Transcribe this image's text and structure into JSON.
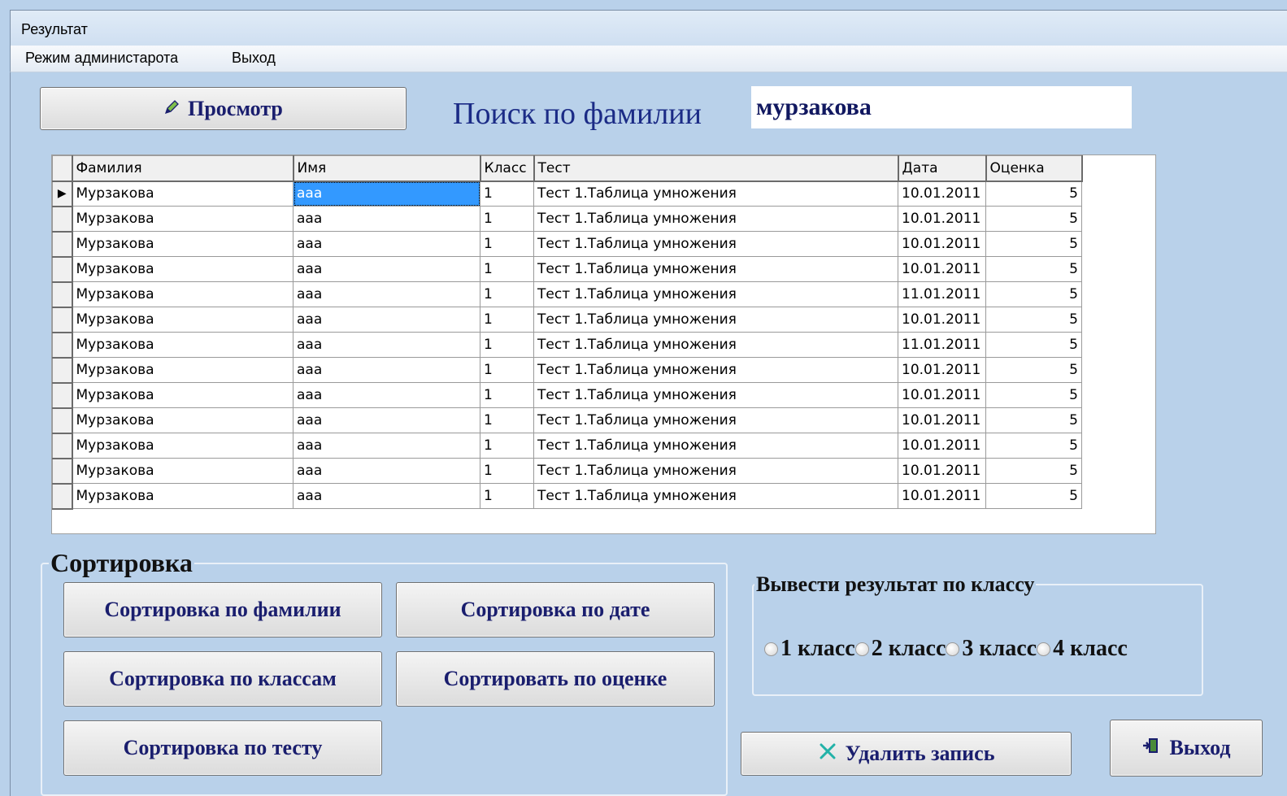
{
  "window": {
    "title": "Результат"
  },
  "menu": {
    "items": [
      "Режим администарота",
      "Выход"
    ]
  },
  "toolbar": {
    "view_label": "Просмотр"
  },
  "search": {
    "label": "Поиск по фамилии",
    "value": "мурзакова"
  },
  "grid": {
    "columns": [
      "Фамилия",
      "Имя",
      "Класс",
      "Тест",
      "Дата",
      "Оценка"
    ],
    "rows": [
      [
        "Мурзакова",
        "ааа",
        "1",
        "Тест 1.Таблица умножения",
        "10.01.2011",
        "5"
      ],
      [
        "Мурзакова",
        "ааа",
        "1",
        "Тест 1.Таблица умножения",
        "10.01.2011",
        "5"
      ],
      [
        "Мурзакова",
        "ааа",
        "1",
        "Тест 1.Таблица умножения",
        "10.01.2011",
        "5"
      ],
      [
        "Мурзакова",
        "ааа",
        "1",
        "Тест 1.Таблица умножения",
        "10.01.2011",
        "5"
      ],
      [
        "Мурзакова",
        "ааа",
        "1",
        "Тест 1.Таблица умножения",
        "11.01.2011",
        "5"
      ],
      [
        "Мурзакова",
        "ааа",
        "1",
        "Тест 1.Таблица умножения",
        "10.01.2011",
        "5"
      ],
      [
        "Мурзакова",
        "ааа",
        "1",
        "Тест 1.Таблица умножения",
        "11.01.2011",
        "5"
      ],
      [
        "Мурзакова",
        "ааа",
        "1",
        "Тест 1.Таблица умножения",
        "10.01.2011",
        "5"
      ],
      [
        "Мурзакова",
        "ааа",
        "1",
        "Тест 1.Таблица умножения",
        "10.01.2011",
        "5"
      ],
      [
        "Мурзакова",
        "ааа",
        "1",
        "Тест 1.Таблица умножения",
        "10.01.2011",
        "5"
      ],
      [
        "Мурзакова",
        "ааа",
        "1",
        "Тест 1.Таблица умножения",
        "10.01.2011",
        "5"
      ],
      [
        "Мурзакова",
        "ааа",
        "1",
        "Тест 1.Таблица умножения",
        "10.01.2011",
        "5"
      ],
      [
        "Мурзакова",
        "ааа",
        "1",
        "Тест 1.Таблица умножения",
        "10.01.2011",
        "5"
      ]
    ],
    "selected_row": 0,
    "selected_col": 1
  },
  "sort": {
    "title": "Сортировка",
    "by_surname": "Сортировка по фамилии",
    "by_date": "Сортировка по дате",
    "by_class": "Сортировка по классам",
    "by_grade": "Сортировать по оценке",
    "by_test": "Сортировка по  тесту"
  },
  "class_filter": {
    "title": "Вывести результат по классу",
    "options": [
      "1 класс",
      "2 класс",
      "3 класс",
      "4 класс"
    ]
  },
  "actions": {
    "delete_label": "Удалить запись",
    "exit_label": "Выход"
  },
  "icons": {
    "view": "pencil-icon",
    "delete": "x-icon",
    "exit": "exit-door-icon"
  },
  "colors": {
    "background": "#b9d1ea",
    "button_text": "#1a1e6e",
    "selection": "#3399ff"
  }
}
